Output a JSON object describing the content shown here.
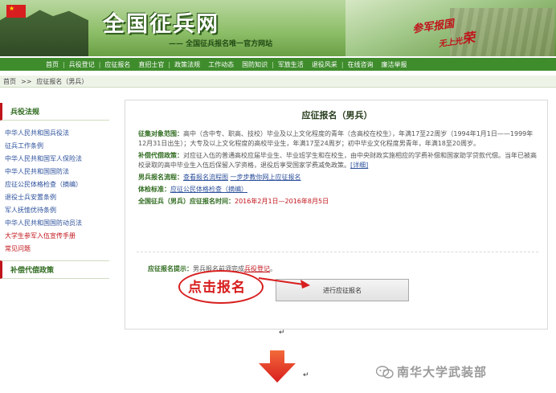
{
  "banner": {
    "site_title": "全国征兵网",
    "site_subtitle": "—— 全国征兵报名唯一官方网站",
    "slogan_line1": "参军报国",
    "slogan_line2_prefix": "无上光",
    "slogan_line2_big": "荣"
  },
  "nav": {
    "items": [
      "首页",
      "兵役登记",
      "应征报名",
      "直招士官",
      "政策法规",
      "工作动态",
      "国防知识",
      "军旅生活",
      "退役风采",
      "在线咨询",
      "廉洁举报"
    ]
  },
  "breadcrumb": {
    "home": "首页",
    "sep": ">>",
    "current": "应征报名（男兵）"
  },
  "sidebar": {
    "section1": "兵役法规",
    "items": [
      "中华人民共和国兵役法",
      "征兵工作条例",
      "中华人民共和国军人保险法",
      "中华人民共和国国防法",
      "应征公民体格检查（摘编）",
      "退役士兵安置条例",
      "军人抚恤优待条例",
      "中华人民共和国国防动员法"
    ],
    "red_items": [
      "大学生参军入伍宣传手册",
      "常见问题"
    ],
    "section2": "补偿代偿政策"
  },
  "main": {
    "title": "应征报名（男兵）",
    "rows": {
      "target_label": "征集对象范围：",
      "target_text": "高中（含中专、职高、技校）毕业及以上文化程度的青年（含高校在校生），年满17至22周岁（1994年1月1日——1999年12月31日出生）；大专及以上文化程度的高校毕业生，年满17至24周岁；初中毕业文化程度男青年，年满18至20周岁。",
      "policy_label": "补偿代偿政策：",
      "policy_text": "对应征入伍的普通高校应届毕业生、毕业班学生和在校生，由中央财政实施相应的学费补偿和国家助学贷款代偿。当年已被高校录取的高中毕业生入伍后保留入学资格，退役后享受国家学费减免政策。",
      "policy_link": "[详细]",
      "process_label": "男兵报名流程：",
      "process_link1": "查看报名流程图",
      "process_link2": "一步步教你网上应征报名",
      "medical_label": "体检标准：",
      "medical_link": "应征公民体格检查（摘编）",
      "time_label": "全国征兵（男兵）应征报名时间：",
      "time_value": "2016年2月1日—2016年8月5日"
    },
    "tip_label": "应征报名提示：",
    "tip_text": "男兵报名前须完成",
    "tip_link": "兵役登记",
    "tip_end": "。",
    "apply_button": "进行应征报名"
  },
  "annotation": {
    "click_label": "点击报名"
  },
  "watermark": {
    "text": "南华大学武装部"
  },
  "colors": {
    "nav_green": "#3f8c2d",
    "title_green": "#2f6b1f",
    "accent_red": "#d81e1e",
    "link_blue": "#2b4f9b"
  }
}
